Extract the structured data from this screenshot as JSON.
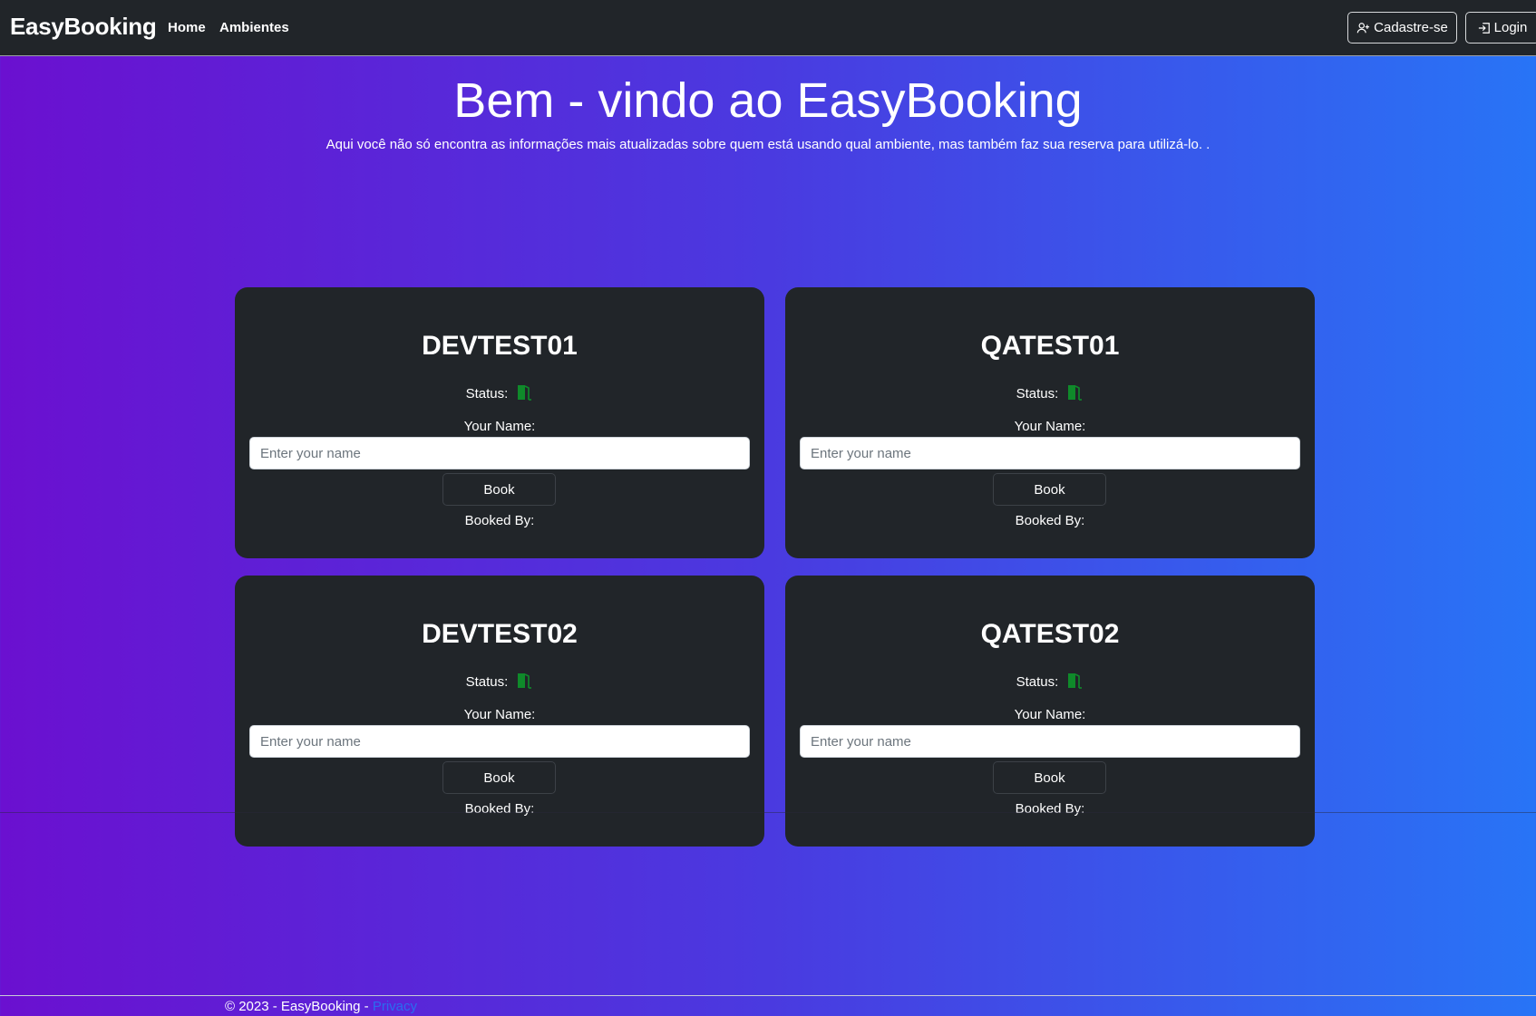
{
  "navbar": {
    "brand": "EasyBooking",
    "links": [
      "Home",
      "Ambientes"
    ],
    "signup_label": "Cadastre-se",
    "login_label": "Login"
  },
  "hero": {
    "title": "Bem - vindo ao EasyBooking",
    "subtitle": "Aqui você não só encontra as informações mais atualizadas sobre quem está usando qual ambiente, mas também faz sua reserva para utilizá-lo. ."
  },
  "environments": [
    {
      "name": "DEVTEST01",
      "status_label": "Status:",
      "status_icon": "door-open-icon",
      "status_color": "#0f8a2a",
      "name_label": "Your Name:",
      "name_placeholder": "Enter your name",
      "name_value": "",
      "book_label": "Book",
      "booked_by_label": "Booked By:"
    },
    {
      "name": "QATEST01",
      "status_label": "Status:",
      "status_icon": "door-open-icon",
      "status_color": "#0f8a2a",
      "name_label": "Your Name:",
      "name_placeholder": "Enter your name",
      "name_value": "",
      "book_label": "Book",
      "booked_by_label": "Booked By:"
    },
    {
      "name": "DEVTEST02",
      "status_label": "Status:",
      "status_icon": "door-open-icon",
      "status_color": "#0f8a2a",
      "name_label": "Your Name:",
      "name_placeholder": "Enter your name",
      "name_value": "",
      "book_label": "Book",
      "booked_by_label": "Booked By:"
    },
    {
      "name": "QATEST02",
      "status_label": "Status:",
      "status_icon": "door-open-icon",
      "status_color": "#0f8a2a",
      "name_label": "Your Name:",
      "name_placeholder": "Enter your name",
      "name_value": "",
      "book_label": "Book",
      "booked_by_label": "Booked By:"
    }
  ],
  "footer": {
    "text": "© 2023 - EasyBooking - ",
    "privacy_label": "Privacy"
  },
  "colors": {
    "navbar_bg": "#212529",
    "card_bg": "#212529",
    "gradient_start": "#6b10d0",
    "gradient_end": "#2874f6",
    "available_status": "#0f8a2a",
    "link": "#2a6cf0"
  }
}
